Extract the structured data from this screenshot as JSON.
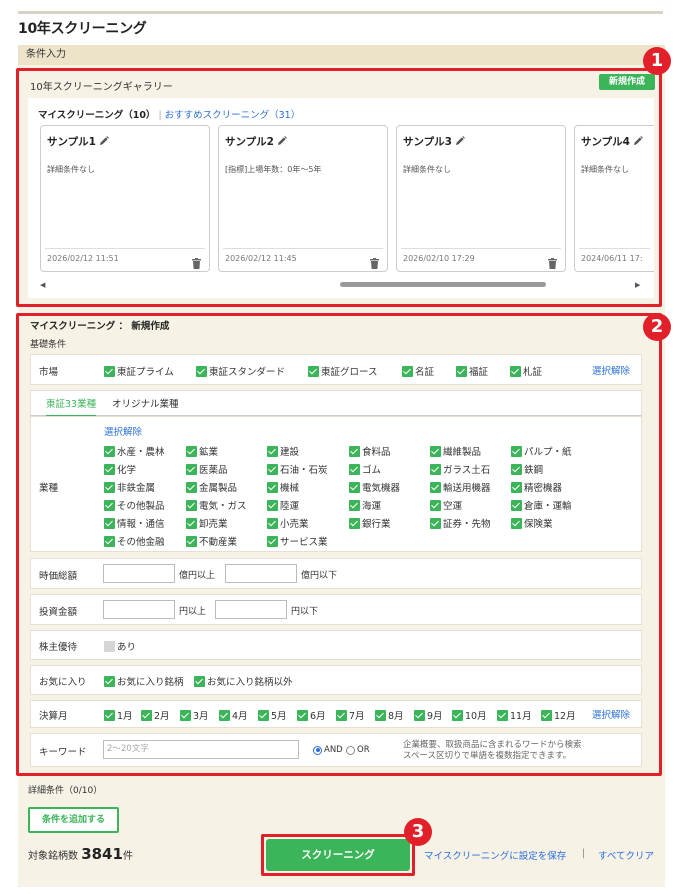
{
  "page_title": "10年スクリーニング",
  "condition_header": "条件入力",
  "badges": [
    "1",
    "2",
    "3"
  ],
  "gallery": {
    "title": "10年スクリーニングギャラリー",
    "new_button": "新規作成",
    "tab_my": "マイスクリーニング（10）",
    "tab_separator": "|",
    "tab_recommended": "おすすめスクリーニング（31）",
    "cards": [
      {
        "title": "サンプル1",
        "desc": "詳細条件なし",
        "date": "2026/02/12 11:51"
      },
      {
        "title": "サンプル2",
        "desc": "[指標]上場年数：0年〜5年",
        "date": "2026/02/12 11:45"
      },
      {
        "title": "サンプル3",
        "desc": "詳細条件なし",
        "date": "2026/02/10 17:29"
      },
      {
        "title": "サンプル4",
        "desc": "詳細条件なし",
        "date": "2024/06/11 17:"
      }
    ]
  },
  "form": {
    "title": "マイスクリーニング ： 新規作成",
    "basic_label": "基礎条件",
    "market": {
      "label": "市場",
      "options": [
        "東証プライム",
        "東証スタンダード",
        "東証グロース",
        "名証",
        "福証",
        "札証"
      ],
      "clear": "選択解除"
    },
    "industry_tabs": [
      "東証33業種",
      "オリジナル業種"
    ],
    "industry": {
      "label": "業種",
      "clear": "選択解除",
      "options": [
        "水産・農林",
        "鉱業",
        "建設",
        "食料品",
        "繊維製品",
        "パルプ・紙",
        "化学",
        "医薬品",
        "石油・石炭",
        "ゴム",
        "ガラス土石",
        "鉄鋼",
        "非鉄金属",
        "金属製品",
        "機械",
        "電気機器",
        "輸送用機器",
        "精密機器",
        "その他製品",
        "電気・ガス",
        "陸運",
        "海運",
        "空運",
        "倉庫・運輸",
        "情報・通信",
        "卸売業",
        "小売業",
        "銀行業",
        "証券・先物",
        "保険業",
        "その他金融",
        "不動産業",
        "サービス業"
      ]
    },
    "market_cap": {
      "label": "時価総額",
      "unit_min": "億円以上",
      "unit_max": "億円以下"
    },
    "investment": {
      "label": "投資金額",
      "unit_min": "円以上",
      "unit_max": "円以下"
    },
    "benefit": {
      "label": "株主優待",
      "option": "あり"
    },
    "favorite": {
      "label": "お気に入り",
      "options": [
        "お気に入り銘柄",
        "お気に入り銘柄以外"
      ]
    },
    "fiscal_month": {
      "label": "決算月",
      "options": [
        "1月",
        "2月",
        "3月",
        "4月",
        "5月",
        "6月",
        "7月",
        "8月",
        "9月",
        "10月",
        "11月",
        "12月"
      ],
      "clear": "選択解除"
    },
    "keyword": {
      "label": "キーワード",
      "placeholder": "2〜20文字",
      "and_label": "AND",
      "or_label": "OR",
      "note_line1": "企業概要、取扱商品に含まれるワードから検索",
      "note_line2": "スペース区切りで単語を複数指定できます。"
    }
  },
  "detail": {
    "label": "詳細条件（0/10）",
    "add_button": "条件を追加する"
  },
  "footer": {
    "count_label": "対象銘柄数",
    "count_value": "3841",
    "count_unit": "件",
    "screen_button": "スクリーニング",
    "save_link": "マイスクリーニングに設定を保存",
    "separator": "|",
    "clear_link": "すべてクリア"
  },
  "colors": {
    "accent_green": "#3cb45a",
    "annotation_red": "#e2202a",
    "link_blue": "#2a6fdb",
    "panel_bg": "#f6f2e6"
  }
}
